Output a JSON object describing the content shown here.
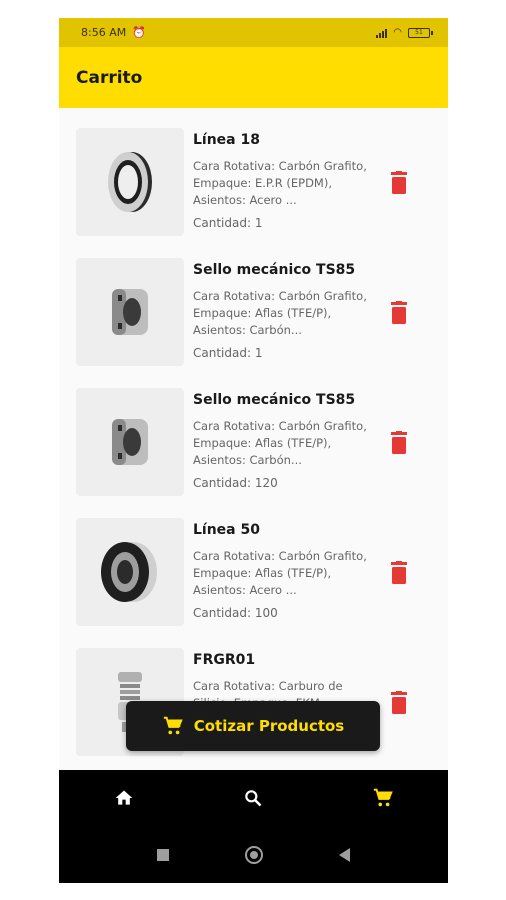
{
  "status": {
    "time": "8:56 AM",
    "battery": "51"
  },
  "appbar": {
    "title": "Carrito"
  },
  "items": [
    {
      "title": "Línea 18",
      "desc": "Cara Rotativa: Carbón Grafito, Empaque: E.P.R (EPDM), Asientos: Acero ...",
      "qty": "Cantidad: 1",
      "icon": "seal-ring"
    },
    {
      "title": "Sello mecánico TS85",
      "desc": "Cara Rotativa: Carbón Grafito, Empaque: Aflas (TFE/P), Asientos: Carbón...",
      "qty": "Cantidad: 1",
      "icon": "mechanical-seal"
    },
    {
      "title": "Sello mecánico TS85",
      "desc": "Cara Rotativa: Carbón Grafito, Empaque: Aflas (TFE/P), Asientos: Carbón...",
      "qty": "Cantidad: 120",
      "icon": "mechanical-seal"
    },
    {
      "title": "Línea 50",
      "desc": "Cara Rotativa: Carbón Grafito, Empaque: Aflas (TFE/P), Asientos: Acero ...",
      "qty": "Cantidad: 100",
      "icon": "seal-ring-large"
    },
    {
      "title": "FRGR01",
      "desc": "Cara Rotativa: Carburo de Silicio, Empaque: FKM",
      "qty": "",
      "icon": "bellows-seal"
    }
  ],
  "cta": {
    "label": "Cotizar Productos"
  },
  "nav": [
    "home-icon",
    "search-icon",
    "cart-icon"
  ],
  "colors": {
    "accent": "#ffdd00",
    "delete": "#e53935",
    "bar": "#000000"
  }
}
